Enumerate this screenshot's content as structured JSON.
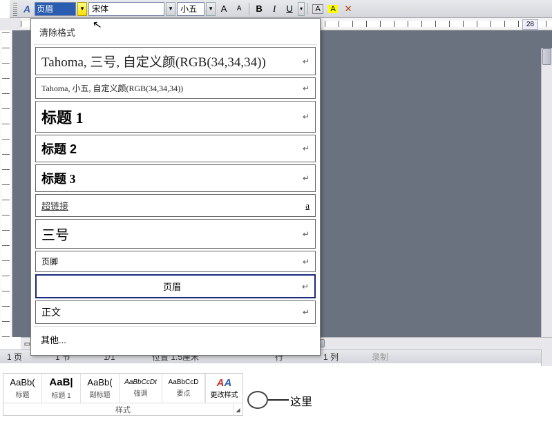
{
  "toolbar": {
    "style_value": "页眉",
    "font_value": "宋体",
    "size_value": "小五",
    "bold": "B",
    "italic": "I",
    "underline": "U",
    "a_glyph": "A",
    "page_badge": "28"
  },
  "style_dropdown": {
    "clear_format": "清除格式",
    "items": [
      {
        "label": "Tahoma, 三号, 自定义颜(RGB(34,34,34))",
        "cls": "sty-tahoma1",
        "ret": true
      },
      {
        "label": "Tahoma, 小五, 自定义颜(RGB(34,34,34))",
        "cls": "sty-tahoma2",
        "ret": true
      },
      {
        "label": "标题 1",
        "cls": "sty-h1",
        "ret": true
      },
      {
        "label": "标题 2",
        "cls": "sty-h2",
        "ret": true
      },
      {
        "label": "标题 3",
        "cls": "sty-h3",
        "ret": true
      },
      {
        "label": "超链接",
        "cls": "sty-link",
        "ret": false,
        "trail": "a"
      },
      {
        "label": "三号",
        "cls": "sty-sanhao",
        "ret": true
      },
      {
        "label": "页脚",
        "cls": "sty-foot",
        "ret": true
      },
      {
        "label": "页眉",
        "cls": "sty-header",
        "ret": true,
        "selected": true,
        "center": true
      },
      {
        "label": "正文",
        "cls": "sty-body",
        "ret": true
      }
    ],
    "more": "其他..."
  },
  "statusbar": {
    "page": "1 页",
    "section": "1 节",
    "pages": "1/1",
    "pos": "位置 1.5厘米",
    "line": "行",
    "col": "1 列",
    "rec": "录制"
  },
  "gallery": {
    "cells": [
      {
        "preview": "AaBb(",
        "label": "标题"
      },
      {
        "preview": "AaB|",
        "label": "标题 1",
        "bold": true
      },
      {
        "preview": "AaBb(",
        "label": "副标题"
      },
      {
        "preview": "AaBbCcDt",
        "label": "强调",
        "italic": true
      },
      {
        "preview": "AaBbCcD",
        "label": "要点"
      }
    ],
    "change_style": "更改样式",
    "footer": "样式"
  },
  "annotation": "这里"
}
